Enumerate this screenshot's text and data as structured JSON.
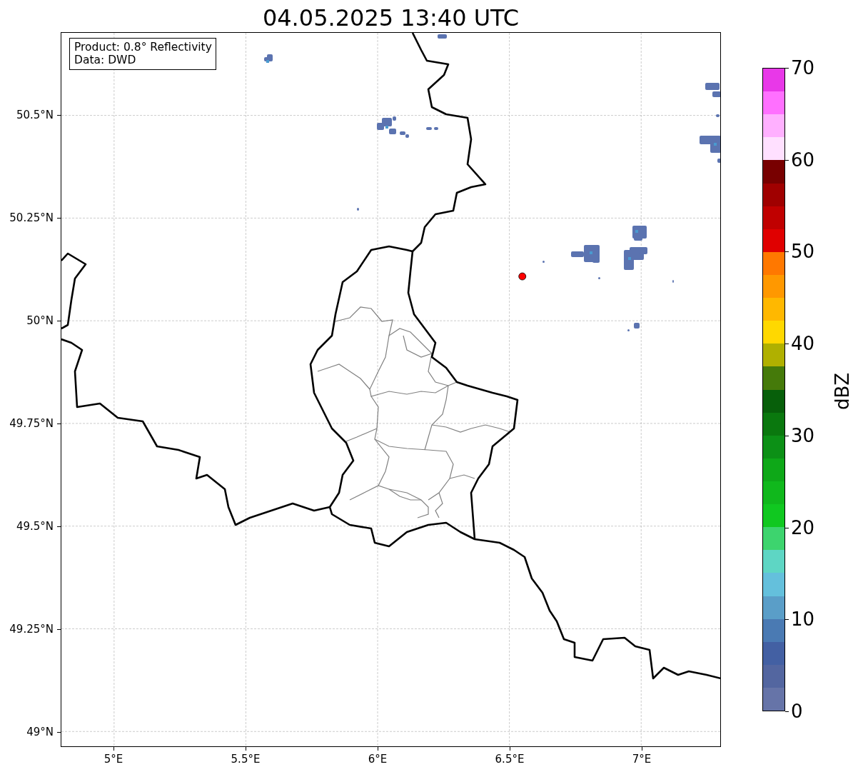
{
  "title": "04.05.2025 13:40 UTC",
  "map": {
    "info_lines": [
      "Product: 0.8° Reflectivity",
      "Data: DWD"
    ],
    "ytick_labels": [
      "50.5°N",
      "50.25°N",
      "50°N",
      "49.75°N",
      "49.5°N",
      "49.25°N",
      "49°N"
    ],
    "xtick_labels": [
      "5°E",
      "5.5°E",
      "6°E",
      "6.5°E",
      "7°E"
    ],
    "marker": {
      "color": "#ff0000"
    }
  },
  "colorbar": {
    "label": "dBZ",
    "bins": [
      {
        "color": "#e838e8"
      },
      {
        "color": "#ff70ff"
      },
      {
        "color": "#ffb0ff"
      },
      {
        "color": "#ffe0ff"
      },
      {
        "color": "#780000"
      },
      {
        "color": "#a00000"
      },
      {
        "color": "#c00000"
      },
      {
        "color": "#e00000"
      },
      {
        "color": "#ff7800"
      },
      {
        "color": "#ff9800"
      },
      {
        "color": "#ffb800"
      },
      {
        "color": "#ffd800"
      },
      {
        "color": "#b0b000"
      },
      {
        "color": "#457a0a"
      },
      {
        "color": "#075f0a"
      },
      {
        "color": "#0a780e"
      },
      {
        "color": "#0c9016"
      },
      {
        "color": "#0ea818"
      },
      {
        "color": "#10b81c"
      },
      {
        "color": "#10c820"
      },
      {
        "color": "#3dd46e"
      },
      {
        "color": "#5ed6c4"
      },
      {
        "color": "#64c0dc"
      },
      {
        "color": "#5a9ec8"
      },
      {
        "color": "#4a7ab3"
      },
      {
        "color": "#4360a3"
      },
      {
        "color": "#5366a0"
      },
      {
        "color": "#6674a8"
      }
    ],
    "tick_labels": [
      "70",
      "60",
      "50",
      "40",
      "30",
      "20",
      "10",
      "0"
    ]
  }
}
